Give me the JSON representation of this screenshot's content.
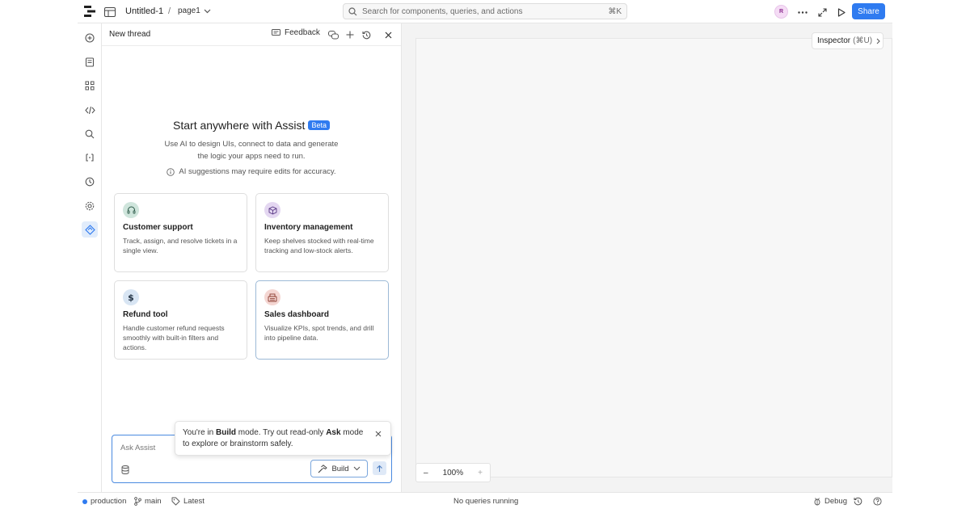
{
  "topbar": {
    "app_title": "Untitled-1",
    "separator": "/",
    "page_name": "page1",
    "search_placeholder": "Search for components, queries, and actions",
    "search_shortcut": "⌘K",
    "avatar_initial": "R",
    "share_label": "Share"
  },
  "assist": {
    "title": "New thread",
    "feedback_label": "Feedback",
    "hero_title": "Start anywhere with Assist",
    "beta_badge": "Beta",
    "hero_subtitle": "Use AI to design UIs, connect to data and generate the logic your apps need to run.",
    "hero_note": "AI suggestions may require edits for accuracy.",
    "cards": [
      {
        "title": "Customer support",
        "description": "Track, assign, and resolve tickets in a single view.",
        "icon": "headset-icon",
        "color": "#cfe5dc"
      },
      {
        "title": "Inventory management",
        "description": "Keep shelves stocked with real-time tracking and low-stock alerts.",
        "icon": "package-icon",
        "color": "#e4d7f1"
      },
      {
        "title": "Refund tool",
        "description": "Handle customer refund requests smoothly with built-in filters and actions.",
        "icon": "dollar-icon",
        "color": "#d8e5f3"
      },
      {
        "title": "Sales dashboard",
        "description": "Visualize KPIs, spot trends, and drill into pipeline data.",
        "icon": "register-icon",
        "color": "#f4d6d2"
      }
    ],
    "composer_placeholder": "Ask Assist",
    "build_label": "Build",
    "tooltip": {
      "pre": "You're in ",
      "mode_build": "Build",
      "mid": " mode. Try out read-only ",
      "mode_ask": "Ask",
      "post": " mode to explore or brainstorm safely."
    }
  },
  "canvas": {
    "inspector_label": "Inspector",
    "inspector_shortcut": "(⌘U)",
    "zoom_minus": "–",
    "zoom_level": "100%",
    "zoom_plus": "+"
  },
  "statusbar": {
    "environment": "production",
    "branch": "main",
    "release": "Latest",
    "query_status": "No queries running",
    "debug_label": "Debug"
  },
  "colors": {
    "accent": "#2f7bf0",
    "accent_light": "#e1ecfb"
  }
}
